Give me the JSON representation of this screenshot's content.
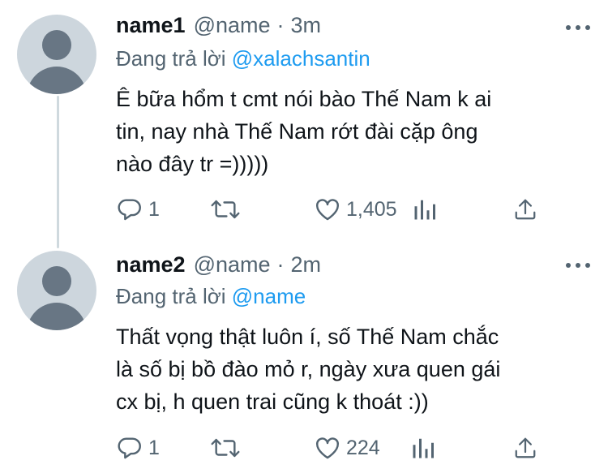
{
  "tweets": [
    {
      "name": "name1",
      "handle": "@name",
      "separator": "·",
      "time": "3m",
      "reply_prefix": "Đang trả lời ",
      "reply_to": "@xalachsantin",
      "lines": [
        "Ê bữa hổm t cmt nói bào Thế Nam k ai",
        "tin, nay nhà Thế Nam rớt đài cặp ông",
        "nào đây tr =)))))"
      ],
      "replies": "1",
      "likes": "1,405"
    },
    {
      "name": "name2",
      "handle": "@name",
      "separator": "·",
      "time": "2m",
      "reply_prefix": "Đang trả lời ",
      "reply_to": "@name",
      "lines": [
        "Thất vọng thật luôn í, số Thế Nam chắc",
        "là số bị bồ đào mỏ r, ngày xưa quen gái",
        "cx bị, h quen trai cũng k thoát :))"
      ],
      "replies": "1",
      "likes": "224"
    }
  ],
  "icons": {
    "more": "more-dots-icon",
    "reply": "reply-bubble-icon",
    "retweet": "retweet-icon",
    "like": "heart-icon",
    "views": "analytics-bars-icon",
    "share": "share-upload-icon"
  },
  "colors": {
    "text": "#0f1419",
    "secondary": "#536471",
    "link": "#1d9bf0",
    "avatar_bg": "#cdd6dd",
    "avatar_fg": "#687684",
    "thread_line": "#cfd9de"
  }
}
